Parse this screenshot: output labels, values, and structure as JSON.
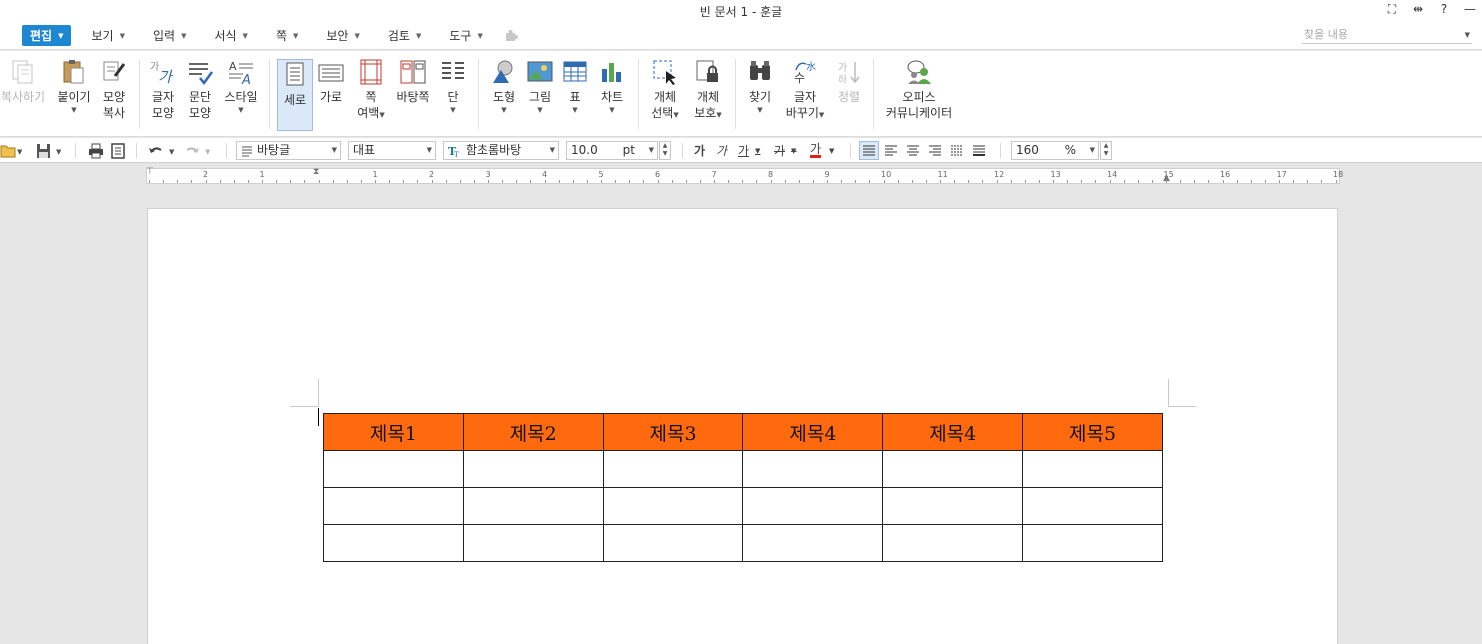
{
  "window": {
    "title": "빈 문서 1 - 훈글",
    "controls": [
      "⛶",
      "⇹",
      "?",
      "—"
    ]
  },
  "menubar": {
    "items": [
      {
        "label": "편집",
        "active": true
      },
      {
        "label": "보기"
      },
      {
        "label": "입력"
      },
      {
        "label": "서식"
      },
      {
        "label": "쪽"
      },
      {
        "label": "보안"
      },
      {
        "label": "검토"
      },
      {
        "label": "도구"
      }
    ],
    "search_placeholder": "찾을 내용"
  },
  "ribbon": {
    "copy": "복사하기",
    "paste": "붙이기",
    "format_copy_1": "모양",
    "format_copy_2": "복사",
    "char_shape_1": "글자",
    "char_shape_2": "모양",
    "para_shape_1": "문단",
    "para_shape_2": "모양",
    "style": "스타일",
    "portrait": "세로",
    "landscape": "가로",
    "margin_1": "쪽",
    "margin_2": "여백",
    "background": "바탕쪽",
    "columns": "단",
    "shape": "도형",
    "picture": "그림",
    "table": "표",
    "chart": "차트",
    "object_select_1": "개체",
    "object_select_2": "선택",
    "object_protect_1": "개체",
    "object_protect_2": "보호",
    "find": "찾기",
    "replace_1": "글자",
    "replace_2": "바꾸기",
    "sort": "정렬",
    "office_1": "오피스",
    "office_2": "커뮤니케이터"
  },
  "toolbar": {
    "style_value": "바탕글",
    "lang_value": "대표",
    "font_value": "함초롬바탕",
    "size_value": "10.0",
    "size_unit": "pt",
    "zoom_value": "160",
    "zoom_unit": "%",
    "bold": "가",
    "italic": "가",
    "underline": "가",
    "strike": "가",
    "font_color": "가"
  },
  "ruler": {
    "labels": [
      "2",
      "1",
      "1",
      "2",
      "3",
      "4",
      "5",
      "6",
      "7",
      "8",
      "9",
      "10",
      "11",
      "12",
      "13",
      "14",
      "15",
      "16",
      "17",
      "18"
    ]
  },
  "document": {
    "table": {
      "header": [
        "제목1",
        "제목2",
        "제목3",
        "제목4",
        "제목4",
        "제목5"
      ],
      "header_color": "#ff6a0f",
      "empty_rows": 3
    }
  }
}
